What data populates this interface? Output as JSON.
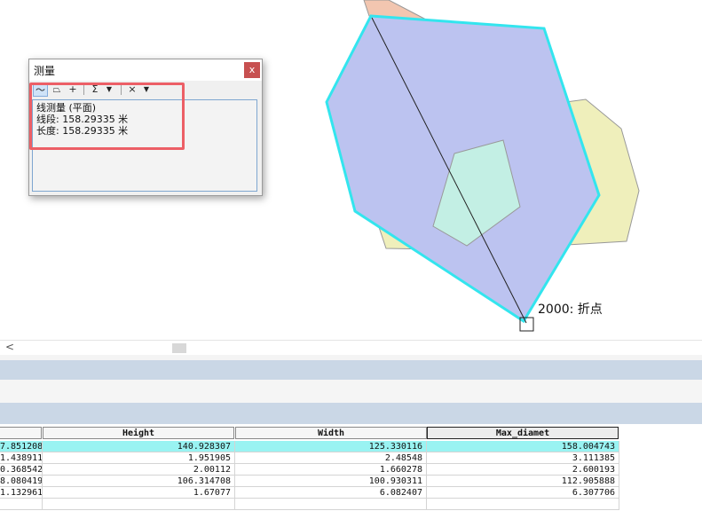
{
  "map": {
    "snap_label": "2000: 折点"
  },
  "measure_dialog": {
    "title": "测量",
    "close": "x",
    "tools": {
      "measure_line": "〜",
      "measure_area": "⏢",
      "measure_feature": "+",
      "sum": "Σ",
      "units_dropdown": "▼",
      "clear": "×",
      "clear_dropdown": "▼"
    },
    "result_lines": [
      "线测量 (平面)",
      "线段: 158.29335 米",
      "长度: 158.29335 米"
    ]
  },
  "scrollbar": {
    "left_arrow": "<"
  },
  "table": {
    "columns": [
      {
        "label": ""
      },
      {
        "label": "Height"
      },
      {
        "label": "Width"
      },
      {
        "label": "Max_diamet"
      }
    ],
    "rows": [
      [
        "7.851208",
        "140.928307",
        "125.330116",
        "158.004743"
      ],
      [
        "1.438911",
        "1.951905",
        "2.48548",
        "3.111385"
      ],
      [
        "0.368542",
        "2.00112",
        "1.660278",
        "2.600193"
      ],
      [
        "8.080419",
        "106.314708",
        "100.930311",
        "112.905888"
      ],
      [
        "1.132961",
        "1.67077",
        "6.082407",
        "6.307706"
      ],
      [
        "",
        "",
        "",
        ""
      ]
    ]
  },
  "colors": {
    "selected_polygon_outline": "#33e5ee",
    "selected_polygon_fill": "#bcc3f0",
    "inner_polygon_fill": "#c3efe4",
    "back_polygon_fill": "#efefbb",
    "top_polygon_fill": "#f2c6b0",
    "highlight_box": "#ec5f66",
    "selected_row": "#99f3f2"
  }
}
